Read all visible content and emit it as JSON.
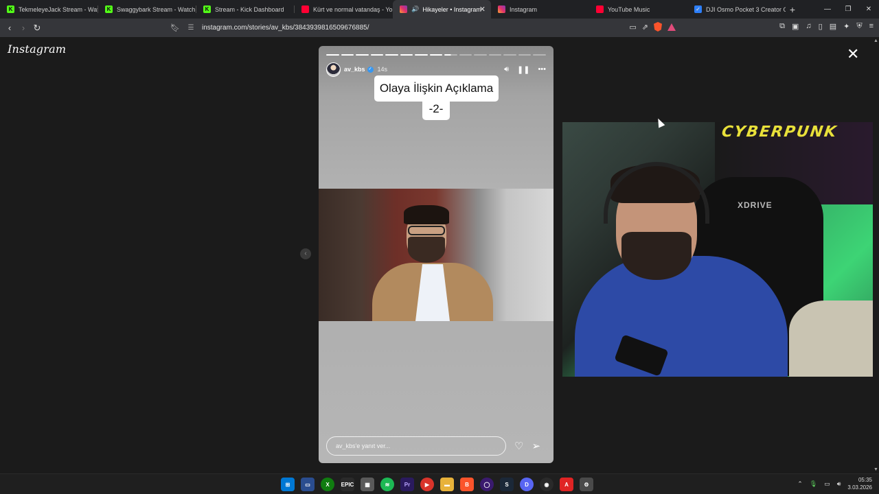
{
  "tabs": [
    {
      "title": "TekmeleyeJack Stream - Watch",
      "favicon": "kick-icon",
      "active": false
    },
    {
      "title": "Swaggybark Stream - Watch Li",
      "favicon": "kick-icon",
      "active": false
    },
    {
      "title": "Stream - Kick Dashboard",
      "favicon": "kick-icon",
      "active": false
    },
    {
      "title": "Kürt ve normal vatandaş - You",
      "favicon": "youtube-icon",
      "active": false
    },
    {
      "title": "Hikayeler • Instagram",
      "favicon": "instagram-icon",
      "active": true,
      "audio": true
    },
    {
      "title": "Instagram",
      "favicon": "instagram-icon",
      "active": false
    },
    {
      "title": "YouTube Music",
      "favicon": "youtube-music-icon",
      "active": false
    },
    {
      "title": "DJI Osmo Pocket 3 Creator Co",
      "favicon": "dji-icon",
      "active": false
    }
  ],
  "omnibox": {
    "url": "instagram.com/stories/av_kbs/3843939816509676885/"
  },
  "page": {
    "logo": "Instagram",
    "story": {
      "username": "av_kbs",
      "verified": true,
      "time": "14s",
      "progress_total": 15,
      "progress_done": 8,
      "title_line1": "Olaya İlişkin Açıklama",
      "title_line2": "-2-",
      "reply_placeholder": "av_kbs'e yanıt ver..."
    },
    "webcam": {
      "poster_text": "CYBERPUNK",
      "chair_logo": "XDRIVE"
    }
  },
  "taskbar": {
    "time": "05:35",
    "date": "3.03.2026"
  },
  "colors": {
    "accent_instagram": "#e1306c",
    "kick_green": "#53fc18",
    "verified_blue": "#3897f0"
  }
}
